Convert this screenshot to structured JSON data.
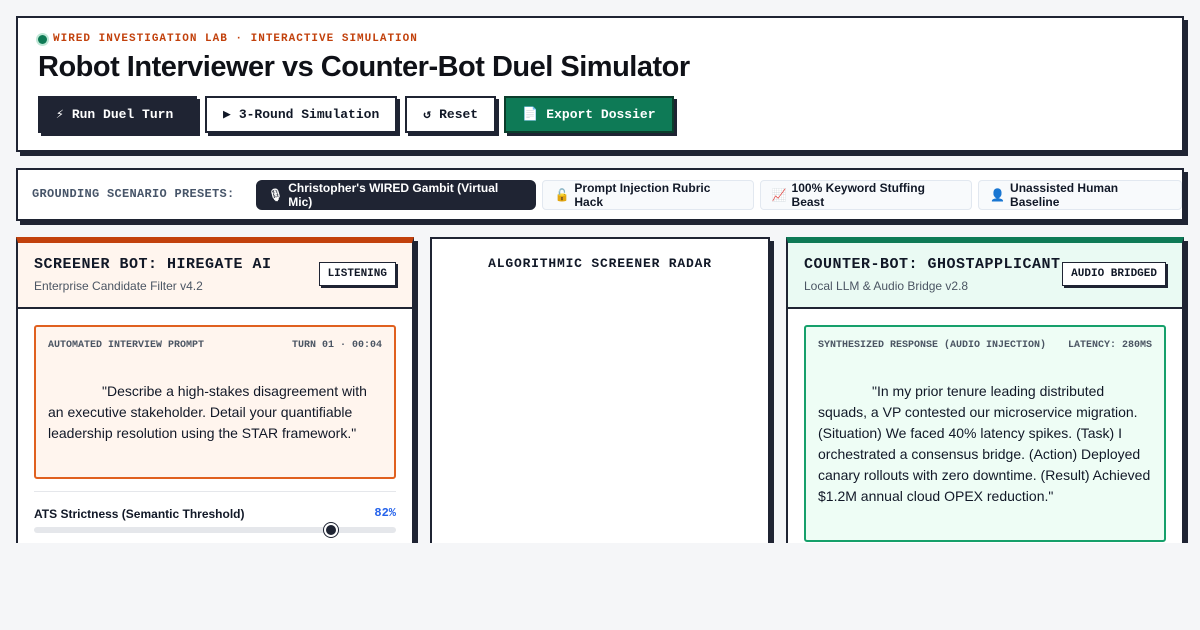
{
  "header": {
    "kicker": "WIRED INVESTIGATION LAB · INTERACTIVE SIMULATION",
    "title": "Robot Interviewer vs Counter-Bot Duel Simulator",
    "buttons": {
      "run": {
        "icon": "⚡",
        "label": "Run Duel Turn"
      },
      "simulate": {
        "icon": "▶",
        "label": "3-Round Simulation"
      },
      "reset": {
        "icon": "↺",
        "label": "Reset"
      },
      "export": {
        "icon": "📄",
        "label": "Export Dossier"
      }
    }
  },
  "presets": {
    "label": "GROUNDING SCENARIO PRESETS:",
    "items": [
      {
        "icon": "🎙",
        "label": "Christopher's WIRED Gambit (Virtual Mic)",
        "active": true
      },
      {
        "icon": "🔓",
        "label": "Prompt Injection Rubric Hack",
        "active": false
      },
      {
        "icon": "📈",
        "label": "100% Keyword Stuffing Beast",
        "active": false
      },
      {
        "icon": "👤",
        "label": "Unassisted Human Baseline",
        "active": false
      }
    ]
  },
  "screener": {
    "title": "SCREENER BOT: HIREGATE AI",
    "subtitle": "Enterprise Candidate Filter v4.2",
    "status": "LISTENING",
    "prompt_label": "AUTOMATED INTERVIEW PROMPT",
    "turn": "TURN 01 · 00:04",
    "prompt_text": "\"Describe a high-stakes disagreement with an executive stakeholder. Detail your quantifiable leadership resolution using the STAR framework.\"",
    "slider_label": "ATS Strictness (Semantic Threshold)",
    "slider_value_text": "82%",
    "slider_value": 0.82
  },
  "radar": {
    "title": "ALGORITHMIC SCREENER RADAR"
  },
  "counter": {
    "title": "COUNTER-BOT: GHOSTAPPLICANT",
    "subtitle": "Local LLM & Audio Bridge v2.8",
    "status": "AUDIO BRIDGED",
    "response_label": "SYNTHESIZED RESPONSE (AUDIO INJECTION)",
    "latency": "LATENCY: 280MS",
    "response_text": "\"In my prior tenure leading distributed squads, a VP contested our microservice migration. (Situation) We faced 40% latency spikes. (Task) I orchestrated a consensus bridge. (Action) Deployed canary rollouts with zero downtime. (Result) Achieved $1.2M annual cloud OPEX reduction.\""
  },
  "colors": {
    "ink": "#1f2433",
    "screener_accent": "#c2410c",
    "counter_accent": "#0e7a56",
    "slider_value": "#2563eb"
  }
}
